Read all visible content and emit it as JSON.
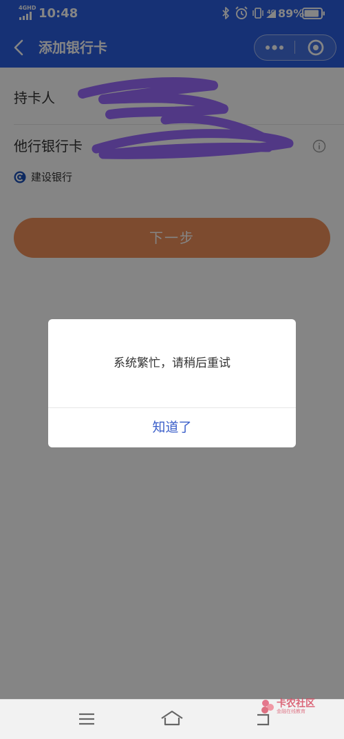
{
  "status_bar": {
    "network_label": "4GHD",
    "time": "10:48",
    "cellular_label": "4G",
    "battery_percent": "89%",
    "battery_level": 0.89
  },
  "nav": {
    "title": "添加银行卡",
    "back_icon": "chevron-left-icon",
    "more_icon": "more-dots-icon",
    "close_icon": "target-circle-icon"
  },
  "form": {
    "cardholder_label": "持卡人",
    "card_label": "他行银行卡",
    "bank_name": "建设银行",
    "next_label": "下一步"
  },
  "dialog": {
    "message": "系统繁忙，请稍后重试",
    "confirm_label": "知道了"
  },
  "watermark": {
    "title": "卡农社区",
    "subtitle": "金融在线教育"
  },
  "colors": {
    "header_blue": "#2b5fe0",
    "button_orange": "#f0915b",
    "dialog_link": "#3a5ec9",
    "scribble_purple": "#9b6bff"
  }
}
